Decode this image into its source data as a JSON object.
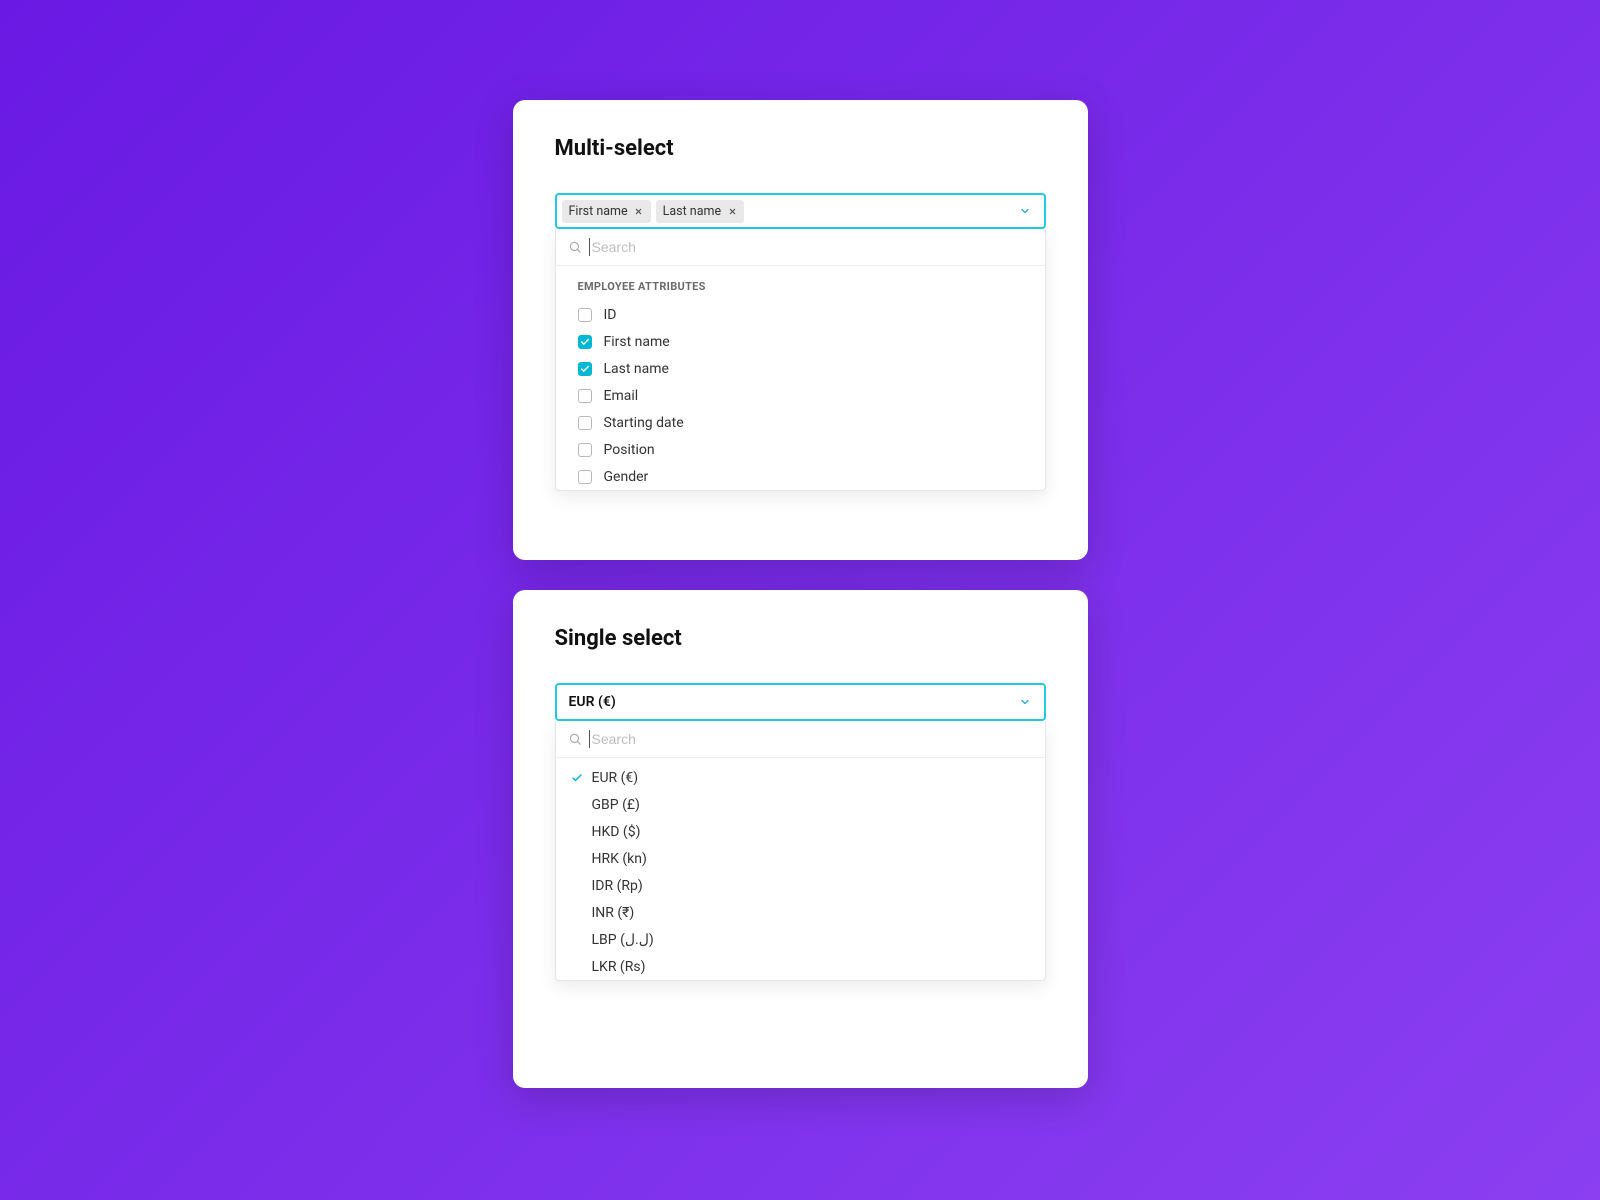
{
  "multiSelect": {
    "title": "Multi-select",
    "searchPlaceholder": "Search",
    "selectedChips": [
      "First name",
      "Last name"
    ],
    "groupHeader": "EMPLOYEE ATTRIBUTES",
    "options": [
      {
        "label": "ID",
        "checked": false
      },
      {
        "label": "First name",
        "checked": true
      },
      {
        "label": "Last name",
        "checked": true
      },
      {
        "label": "Email",
        "checked": false
      },
      {
        "label": "Starting date",
        "checked": false
      },
      {
        "label": "Position",
        "checked": false
      },
      {
        "label": "Gender",
        "checked": false
      }
    ]
  },
  "singleSelect": {
    "title": "Single select",
    "searchPlaceholder": "Search",
    "selectedValue": "EUR (€)",
    "options": [
      {
        "label": "EUR (€)",
        "selected": true
      },
      {
        "label": "GBP (£)",
        "selected": false
      },
      {
        "label": "HKD ($)",
        "selected": false
      },
      {
        "label": "HRK (kn)",
        "selected": false
      },
      {
        "label": "IDR (Rp)",
        "selected": false
      },
      {
        "label": "INR (₹)",
        "selected": false
      },
      {
        "label": "LBP (ل.ل)",
        "selected": false
      },
      {
        "label": "LKR (Rs)",
        "selected": false
      }
    ]
  }
}
